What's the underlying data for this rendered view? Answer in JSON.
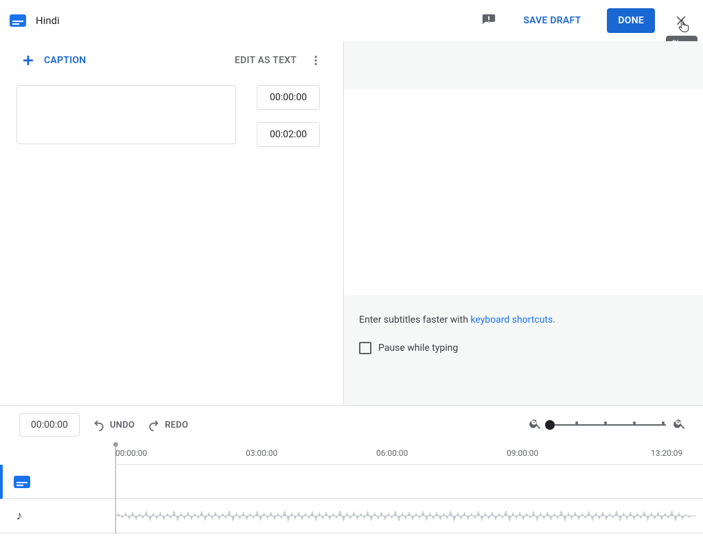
{
  "header": {
    "language": "Hindi",
    "save_draft_label": "SAVE DRAFT",
    "done_label": "DONE",
    "close_tooltip": "Close"
  },
  "left": {
    "add_caption_label": "CAPTION",
    "edit_as_text_label": "EDIT AS TEXT",
    "caption_text": "",
    "start_time": "00:00:00",
    "end_time": "00:02:00"
  },
  "right": {
    "hint_prefix": "Enter subtitles faster with ",
    "hint_link": "keyboard shortcuts",
    "hint_suffix": ".",
    "pause_label": "Pause while typing"
  },
  "timeline": {
    "current_time": "00:00:00",
    "undo_label": "UNDO",
    "redo_label": "REDO",
    "ticks": [
      "00:00:00",
      "03:00:00",
      "06:00:00",
      "09:00:00",
      "13:20:09"
    ]
  }
}
